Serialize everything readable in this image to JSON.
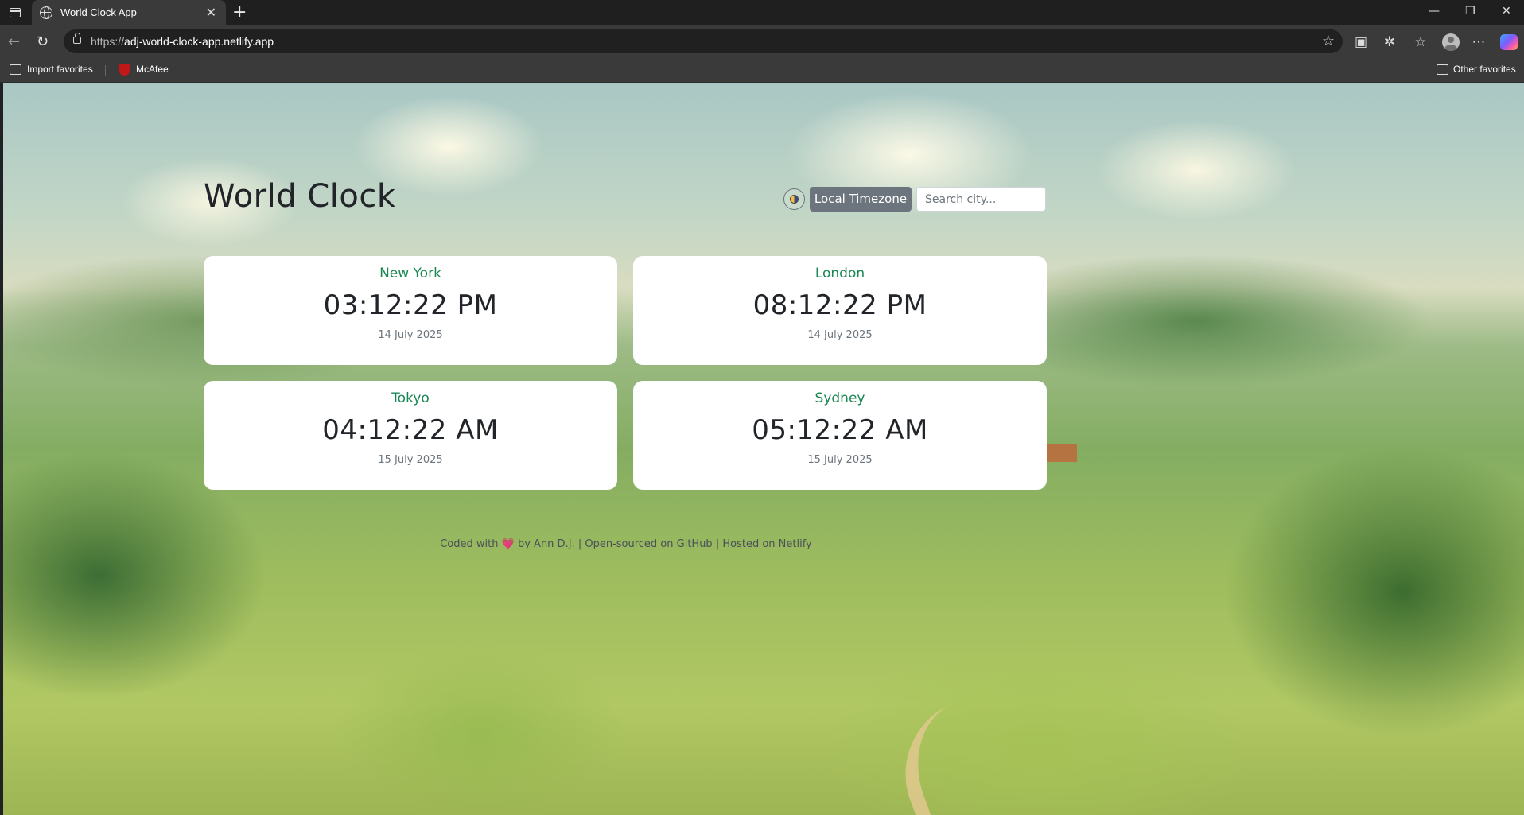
{
  "browser": {
    "tab_title": "World Clock App",
    "tab_close": "✕",
    "new_tab": "+",
    "url_scheme": "https://",
    "url_host": "adj-world-clock-app.netlify.app",
    "favorites": {
      "import_label": "Import favorites",
      "mcafee_label": "McAfee",
      "other_label": "Other favorites"
    },
    "window_controls": {
      "minimize": "—",
      "restore": "❐",
      "close": "✕"
    }
  },
  "app": {
    "title": "World Clock",
    "local_button": "Local Timezone",
    "search_placeholder": "Search city...",
    "clocks": [
      {
        "city": "New York",
        "time": "03:12:22 PM",
        "date": "14 July 2025"
      },
      {
        "city": "London",
        "time": "08:12:22 PM",
        "date": "14 July 2025"
      },
      {
        "city": "Tokyo",
        "time": "04:12:22 AM",
        "date": "15 July 2025"
      },
      {
        "city": "Sydney",
        "time": "05:12:22 AM",
        "date": "15 July 2025"
      }
    ],
    "footer": {
      "coded_with": "Coded with",
      "heart": "💗",
      "by": "by",
      "author": "Ann D.J.",
      "sep": "|",
      "github": "Open-sourced on GitHub",
      "netlify": "Hosted on Netlify"
    }
  },
  "colors": {
    "city_accent": "#198754",
    "button_bg": "#6c757d"
  }
}
